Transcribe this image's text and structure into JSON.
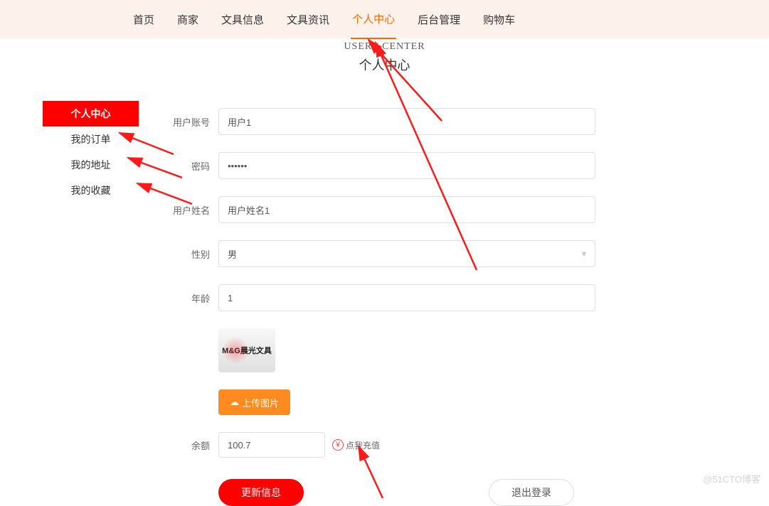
{
  "nav": {
    "items": [
      "首页",
      "商家",
      "文具信息",
      "文具资讯",
      "个人中心",
      "后台管理",
      "购物车"
    ],
    "activeIndex": 4
  },
  "header": {
    "sub": "USER / CENTER",
    "title": "个人中心"
  },
  "sidebar": {
    "items": [
      "个人中心",
      "我的订单",
      "我的地址",
      "我的收藏"
    ],
    "activeIndex": 0
  },
  "form": {
    "usernameLabel": "用户账号",
    "username": "用户1",
    "passwordLabel": "密码",
    "password": "••••••",
    "nameLabel": "用户姓名",
    "name": "用户姓名1",
    "genderLabel": "性别",
    "gender": "男",
    "ageLabel": "年龄",
    "age": "1",
    "uploadLabel": "上传图片",
    "avatarText": "M&G晨光文具",
    "balanceLabel": "余额",
    "balance": "100.7",
    "rechargeText": "点我充值",
    "submitLabel": "更新信息",
    "logoutLabel": "退出登录"
  },
  "watermark": "@51CTO博客"
}
